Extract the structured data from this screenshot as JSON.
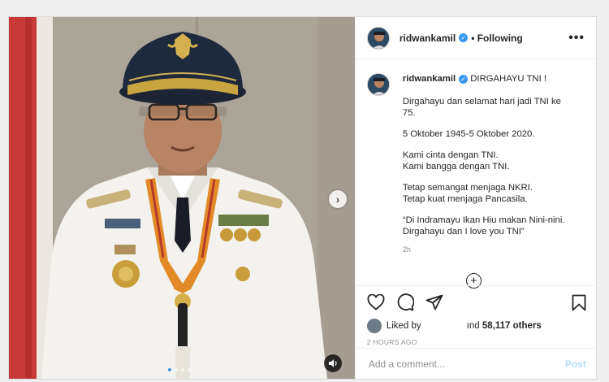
{
  "post": {
    "username": "ridwankamil",
    "following_label": "• Following",
    "more_icon": "more-horizontal-icon",
    "caption": {
      "username": "ridwankamil",
      "headline": "DIRGAHAYU TNI !",
      "paragraphs": [
        "Dirgahayu dan selamat hari jadi TNI ke 75.",
        "5 Oktober 1945-5 Oktober 2020.",
        "Kami cinta dengan TNI.\nKami bangga dengan TNI.",
        "Tetap semangat menjaga NKRI.\nTetap kuat menjaga Pancasila.",
        "“Di Indramayu Ikan Hiu makan Nini-nini. Dirgahayu dan I love you TNI”"
      ],
      "time": "2h"
    },
    "load_more": "+",
    "likes": {
      "prefix": "Liked by",
      "fragment": "ınd",
      "count": "58,117 others"
    },
    "posted_ago": "2 HOURS AGO",
    "comment_placeholder": "Add a comment...",
    "post_button": "Post"
  },
  "media": {
    "slide_count": 4,
    "active_slide": 1
  },
  "colors": {
    "accent": "#3897f0",
    "post_disabled": "#b2dffc"
  }
}
